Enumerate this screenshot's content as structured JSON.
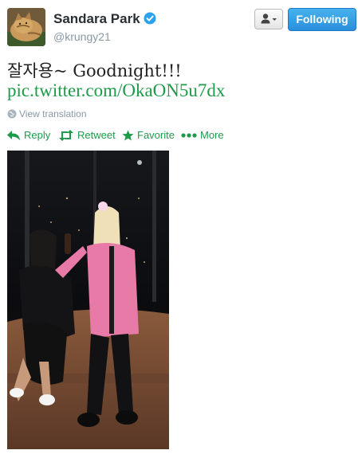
{
  "profile": {
    "display_name": "Sandara Park",
    "username": "@krungy21",
    "follow_label": "Following",
    "avatar_icon": "cat-photo-avatar",
    "verified_icon": "verified-badge-icon"
  },
  "tweet": {
    "text": "잘자용~ Goodnight!!!",
    "link": "pic.twitter.com/OkaON5u7dx",
    "translate_label": "View translation"
  },
  "actions": {
    "reply": "Reply",
    "retweet": "Retweet",
    "favorite": "Favorite",
    "more": "More"
  },
  "colors": {
    "accent": "#1d9b4a",
    "follow_button": "#2a8fdc",
    "verified": "#2aa3ef",
    "muted": "#8899a6"
  }
}
